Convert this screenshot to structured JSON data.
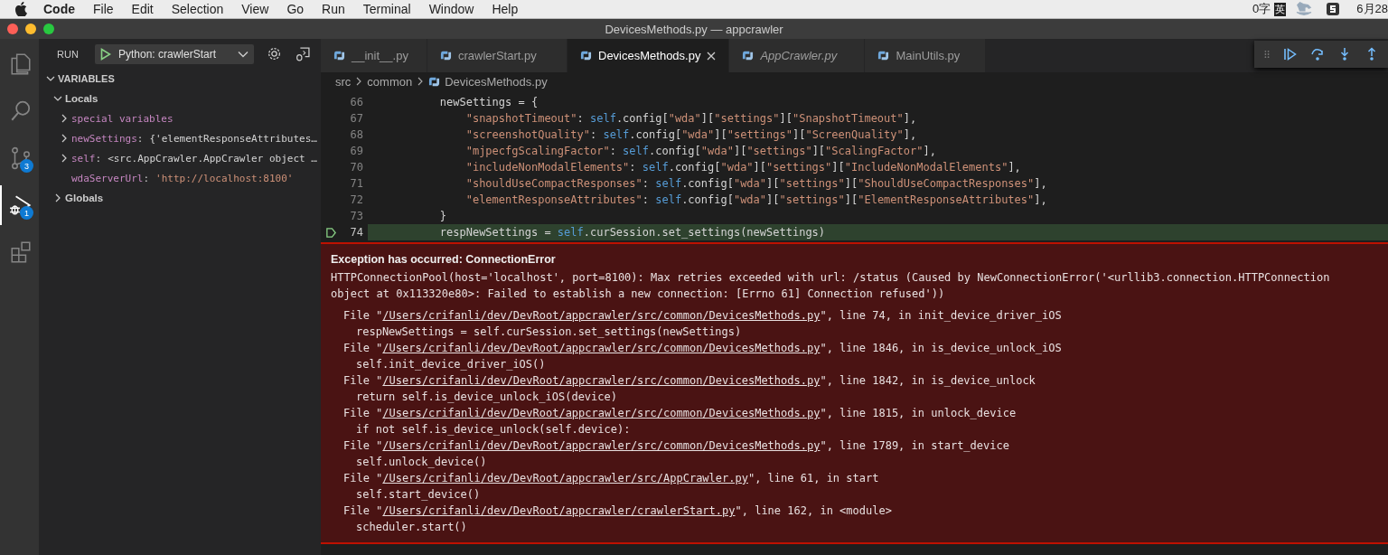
{
  "menu_bar": {
    "app": "Code",
    "items": [
      "File",
      "Edit",
      "Selection",
      "View",
      "Go",
      "Run",
      "Terminal",
      "Window",
      "Help"
    ],
    "status": {
      "word_count": "0字",
      "input_mode": "英",
      "clock": "6月28"
    }
  },
  "window": {
    "title": "DevicesMethods.py — appcrawler"
  },
  "activity_bar": [
    {
      "kind": "files",
      "selected": false
    },
    {
      "kind": "search",
      "selected": false
    },
    {
      "kind": "scm",
      "selected": false,
      "badge": "3"
    },
    {
      "kind": "debug",
      "selected": true,
      "badge": "1"
    },
    {
      "kind": "extensions",
      "selected": false
    }
  ],
  "sidebar": {
    "title": "RUN",
    "config": "Python: crawlerStart",
    "section": "VARIABLES",
    "expanded": true,
    "scopes": [
      {
        "label": "Locals",
        "expanded": true,
        "children": [
          {
            "name": "special variables",
            "expandable": true
          },
          {
            "name": "newSettings",
            "separator": ":",
            "value": "{'elementResponseAttributes…",
            "expandable": true,
            "kind": "object"
          },
          {
            "name": "self",
            "separator": ":",
            "value": "<src.AppCrawler.AppCrawler object …",
            "expandable": true,
            "kind": "object"
          },
          {
            "name": "wdaServerUrl",
            "separator": ":",
            "value": "'http://localhost:8100'",
            "expandable": false,
            "kind": "string"
          }
        ]
      },
      {
        "label": "Globals",
        "expanded": false
      }
    ]
  },
  "tabs": [
    {
      "label": "__init__.py",
      "selected": false,
      "preview": false
    },
    {
      "label": "crawlerStart.py",
      "selected": false,
      "preview": false
    },
    {
      "label": "DevicesMethods.py",
      "selected": true,
      "preview": false
    },
    {
      "label": "AppCrawler.py",
      "selected": false,
      "preview": true
    },
    {
      "label": "MainUtils.py",
      "selected": false,
      "preview": false
    }
  ],
  "breadcrumb": [
    "src",
    "common",
    "DevicesMethods.py"
  ],
  "code": [
    {
      "number": "66",
      "current": false,
      "tokens": [
        {
          "kind": "plain",
          "text": "        newSettings = {"
        }
      ]
    },
    {
      "number": "67",
      "current": false,
      "tokens": [
        {
          "kind": "string",
          "text": "            \"snapshotTimeout\""
        },
        {
          "kind": "plain",
          "text": ": "
        },
        {
          "kind": "keyword",
          "text": "self"
        },
        {
          "kind": "plain",
          "text": ".config["
        },
        {
          "kind": "string",
          "text": "\"wda\""
        },
        {
          "kind": "plain",
          "text": "]["
        },
        {
          "kind": "string",
          "text": "\"settings\""
        },
        {
          "kind": "plain",
          "text": "]["
        },
        {
          "kind": "string",
          "text": "\"SnapshotTimeout\""
        },
        {
          "kind": "plain",
          "text": "],"
        }
      ]
    },
    {
      "number": "68",
      "current": false,
      "tokens": [
        {
          "kind": "string",
          "text": "            \"screenshotQuality\""
        },
        {
          "kind": "plain",
          "text": ": "
        },
        {
          "kind": "keyword",
          "text": "self"
        },
        {
          "kind": "plain",
          "text": ".config["
        },
        {
          "kind": "string",
          "text": "\"wda\""
        },
        {
          "kind": "plain",
          "text": "]["
        },
        {
          "kind": "string",
          "text": "\"settings\""
        },
        {
          "kind": "plain",
          "text": "]["
        },
        {
          "kind": "string",
          "text": "\"ScreenQuality\""
        },
        {
          "kind": "plain",
          "text": "],"
        }
      ]
    },
    {
      "number": "69",
      "current": false,
      "tokens": [
        {
          "kind": "string",
          "text": "            \"mjpecfgScalingFactor\""
        },
        {
          "kind": "plain",
          "text": ": "
        },
        {
          "kind": "keyword",
          "text": "self"
        },
        {
          "kind": "plain",
          "text": ".config["
        },
        {
          "kind": "string",
          "text": "\"wda\""
        },
        {
          "kind": "plain",
          "text": "]["
        },
        {
          "kind": "string",
          "text": "\"settings\""
        },
        {
          "kind": "plain",
          "text": "]["
        },
        {
          "kind": "string",
          "text": "\"ScalingFactor\""
        },
        {
          "kind": "plain",
          "text": "],"
        }
      ]
    },
    {
      "number": "70",
      "current": false,
      "tokens": [
        {
          "kind": "string",
          "text": "            \"includeNonModalElements\""
        },
        {
          "kind": "plain",
          "text": ": "
        },
        {
          "kind": "keyword",
          "text": "self"
        },
        {
          "kind": "plain",
          "text": ".config["
        },
        {
          "kind": "string",
          "text": "\"wda\""
        },
        {
          "kind": "plain",
          "text": "]["
        },
        {
          "kind": "string",
          "text": "\"settings\""
        },
        {
          "kind": "plain",
          "text": "]["
        },
        {
          "kind": "string",
          "text": "\"IncludeNonModalElements\""
        },
        {
          "kind": "plain",
          "text": "],"
        }
      ]
    },
    {
      "number": "71",
      "current": false,
      "tokens": [
        {
          "kind": "string",
          "text": "            \"shouldUseCompactResponses\""
        },
        {
          "kind": "plain",
          "text": ": "
        },
        {
          "kind": "keyword",
          "text": "self"
        },
        {
          "kind": "plain",
          "text": ".config["
        },
        {
          "kind": "string",
          "text": "\"wda\""
        },
        {
          "kind": "plain",
          "text": "]["
        },
        {
          "kind": "string",
          "text": "\"settings\""
        },
        {
          "kind": "plain",
          "text": "]["
        },
        {
          "kind": "string",
          "text": "\"ShouldUseCompactResponses\""
        },
        {
          "kind": "plain",
          "text": "],"
        }
      ]
    },
    {
      "number": "72",
      "current": false,
      "tokens": [
        {
          "kind": "string",
          "text": "            \"elementResponseAttributes\""
        },
        {
          "kind": "plain",
          "text": ": "
        },
        {
          "kind": "keyword",
          "text": "self"
        },
        {
          "kind": "plain",
          "text": ".config["
        },
        {
          "kind": "string",
          "text": "\"wda\""
        },
        {
          "kind": "plain",
          "text": "]["
        },
        {
          "kind": "string",
          "text": "\"settings\""
        },
        {
          "kind": "plain",
          "text": "]["
        },
        {
          "kind": "string",
          "text": "\"ElementResponseAttributes\""
        },
        {
          "kind": "plain",
          "text": "],"
        }
      ]
    },
    {
      "number": "73",
      "current": false,
      "tokens": [
        {
          "kind": "plain",
          "text": "        }"
        }
      ]
    },
    {
      "number": "74",
      "current": true,
      "tokens": [
        {
          "kind": "plain",
          "text": "        respNewSettings = "
        },
        {
          "kind": "keyword",
          "text": "self"
        },
        {
          "kind": "plain",
          "text": ".curSession.set_settings(newSettings)"
        }
      ]
    }
  ],
  "exception": {
    "title": "Exception has occurred: ConnectionError",
    "message": "HTTPConnectionPool(host='localhost', port=8100): Max retries exceeded with url: /status (Caused by NewConnectionError('<urllib3.connection.HTTPConnection object at 0x113320e80>: Failed to establish a new connection: [Errno 61] Connection refused'))",
    "frames": [
      {
        "prefix": "File \"",
        "path": "/Users/crifanli/dev/DevRoot/appcrawler/src/common/DevicesMethods.py",
        "suffix": "\", line 74, in init_device_driver_iOS",
        "code": "respNewSettings = self.curSession.set_settings(newSettings)"
      },
      {
        "prefix": "File \"",
        "path": "/Users/crifanli/dev/DevRoot/appcrawler/src/common/DevicesMethods.py",
        "suffix": "\", line 1846, in is_device_unlock_iOS",
        "code": "self.init_device_driver_iOS()"
      },
      {
        "prefix": "File \"",
        "path": "/Users/crifanli/dev/DevRoot/appcrawler/src/common/DevicesMethods.py",
        "suffix": "\", line 1842, in is_device_unlock",
        "code": "return self.is_device_unlock_iOS(device)"
      },
      {
        "prefix": "File \"",
        "path": "/Users/crifanli/dev/DevRoot/appcrawler/src/common/DevicesMethods.py",
        "suffix": "\", line 1815, in unlock_device",
        "code": "if not self.is_device_unlock(self.device):"
      },
      {
        "prefix": "File \"",
        "path": "/Users/crifanli/dev/DevRoot/appcrawler/src/common/DevicesMethods.py",
        "suffix": "\", line 1789, in start_device",
        "code": "self.unlock_device()"
      },
      {
        "prefix": "File \"",
        "path": "/Users/crifanli/dev/DevRoot/appcrawler/src/AppCrawler.py",
        "suffix": "\", line 61, in start",
        "code": "self.start_device()"
      },
      {
        "prefix": "File \"",
        "path": "/Users/crifanli/dev/DevRoot/appcrawler/crawlerStart.py",
        "suffix": "\", line 162, in <module>",
        "code": "scheduler.start()"
      }
    ]
  }
}
